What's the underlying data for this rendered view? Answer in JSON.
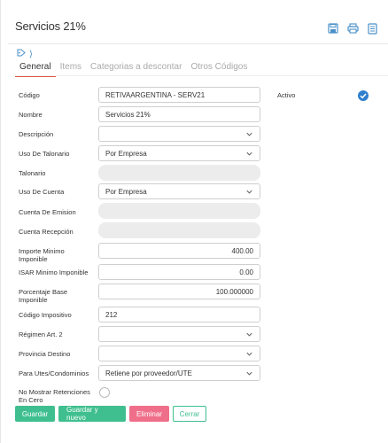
{
  "header": {
    "title": "Servicios 21%",
    "tools": [
      "save-icon",
      "print-icon",
      "document-icon",
      "chevron-icon"
    ]
  },
  "tag_arrow": "⟩",
  "tabs": [
    {
      "label": "General",
      "active": true
    },
    {
      "label": "Items",
      "active": false
    },
    {
      "label": "Categorias a descontar",
      "active": false
    },
    {
      "label": "Otros Códigos",
      "active": false
    }
  ],
  "form": {
    "codigo": {
      "label": "Código",
      "value": "RETIVAARGENTINA - SERV21"
    },
    "nombre": {
      "label": "Nombre",
      "value": "Servicios 21%"
    },
    "descripcion": {
      "label": "Descripción",
      "value": ""
    },
    "uso_talonario": {
      "label": "Uso De Talonario",
      "value": "Por Empresa"
    },
    "talonario": {
      "label": "Talonario",
      "value": ""
    },
    "uso_cuenta": {
      "label": "Uso De Cuenta",
      "value": "Por Empresa"
    },
    "cuenta_emision": {
      "label": "Cuenta De Emision",
      "value": ""
    },
    "cuenta_recepcion": {
      "label": "Cuenta Recepción",
      "value": ""
    },
    "importe_minimo": {
      "label": "Importe Minimo Imponible",
      "value": "400.00"
    },
    "isar_minimo": {
      "label": "ISAR Minimo Imponible",
      "value": "0.00"
    },
    "porcentaje_base": {
      "label": "Porcentaje Base Imponible",
      "value": "100.000000"
    },
    "codigo_impositivo": {
      "label": "Código Impositivo",
      "value": "212"
    },
    "regimen": {
      "label": "Régimen Art. 2",
      "value": ""
    },
    "provincia": {
      "label": "Provincia Destino",
      "value": ""
    },
    "utes": {
      "label": "Para Utes/Condominios",
      "value": "Retiene por proveedor/UTE"
    },
    "no_mostrar": {
      "label": "No Mostrar Retenciones En Cero"
    }
  },
  "activo": {
    "label": "Activo",
    "checked": true
  },
  "buttons": {
    "guardar": "Guardar",
    "guardar_nuevo": "Guardar y nuevo",
    "eliminar": "Eliminar",
    "cerrar": "Cerrar"
  },
  "colors": {
    "accent_blue": "#2f7fd0",
    "tab_underline": "#e0543f",
    "green": "#3fbf8f",
    "pink": "#ef6f8a"
  }
}
